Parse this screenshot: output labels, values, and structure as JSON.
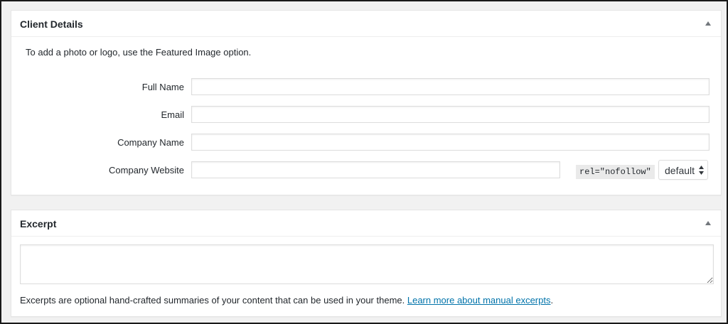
{
  "client_details": {
    "title": "Client Details",
    "intro": "To add a photo or logo, use the Featured Image option.",
    "fields": {
      "full_name": {
        "label": "Full Name",
        "value": ""
      },
      "email": {
        "label": "Email",
        "value": ""
      },
      "company_name": {
        "label": "Company Name",
        "value": ""
      },
      "company_website": {
        "label": "Company Website",
        "value": ""
      }
    },
    "rel_code": "rel=\"nofollow\"",
    "rel_select": {
      "selected": "default"
    }
  },
  "excerpt": {
    "title": "Excerpt",
    "value": "",
    "help_text": "Excerpts are optional hand-crafted summaries of your content that can be used in your theme. ",
    "help_link": "Learn more about manual excerpts",
    "help_suffix": "."
  },
  "icons": {
    "toggle": "triangle-up-icon",
    "select_arrows": "updown-arrows-icon"
  }
}
